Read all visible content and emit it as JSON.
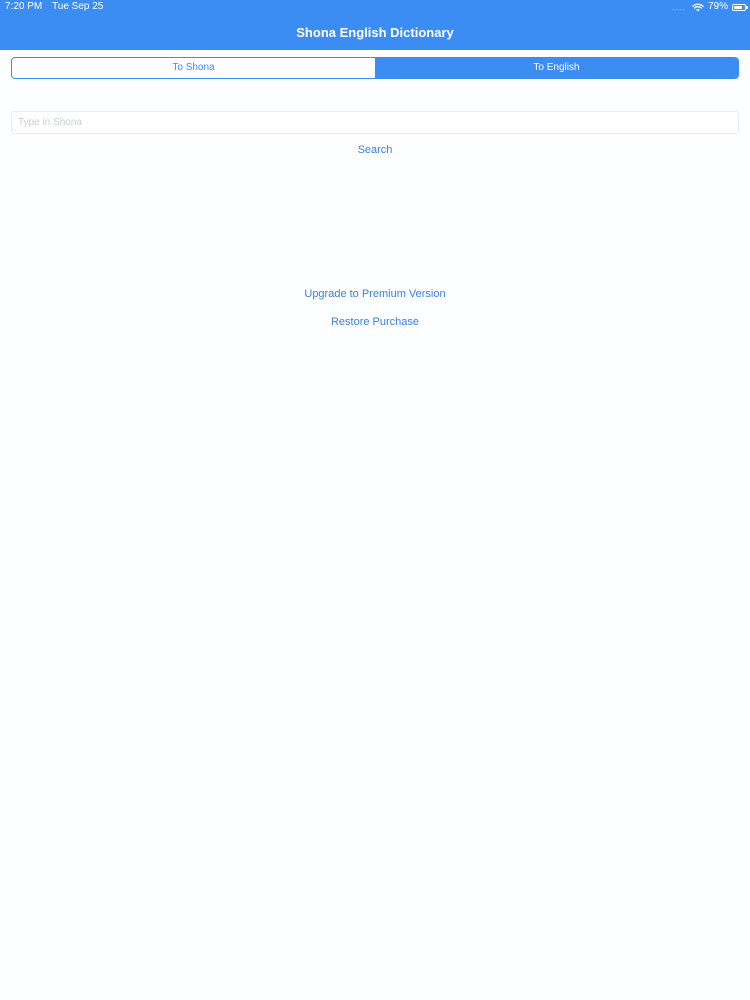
{
  "status_bar": {
    "time": "7:20 PM",
    "date": "Tue Sep 25",
    "signal_dots": "....",
    "battery_percent": "79%",
    "icons": [
      "wifi-icon",
      "battery-icon"
    ]
  },
  "nav": {
    "title": "Shona English Dictionary"
  },
  "segmented_control": {
    "options": [
      {
        "label": "To Shona",
        "selected": false
      },
      {
        "label": "To English",
        "selected": true
      }
    ]
  },
  "search": {
    "placeholder": "Type in Shona",
    "value": "",
    "button_label": "Search"
  },
  "purchase": {
    "upgrade_label": "Upgrade to Premium Version",
    "restore_label": "Restore Purchase"
  },
  "colors": {
    "accent": "#3b8df3",
    "link": "#3b7fe0",
    "background": "#fdfeff"
  }
}
